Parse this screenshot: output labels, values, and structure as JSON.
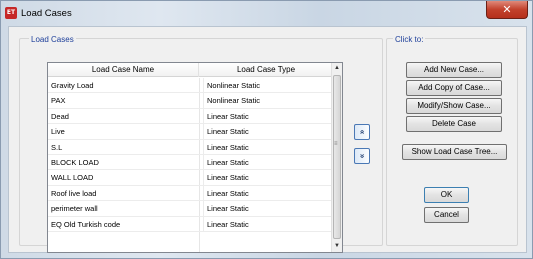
{
  "window": {
    "title": "Load Cases",
    "app_icon": "ET",
    "close_glyph": "✕"
  },
  "load_cases_group": {
    "title": "Load Cases",
    "columns": [
      "Load Case Name",
      "Load Case Type"
    ],
    "rows": [
      {
        "name": "Gravity Load",
        "type": "Nonlinear Static"
      },
      {
        "name": "PAX",
        "type": "Nonlinear Static"
      },
      {
        "name": "Dead",
        "type": "Linear Static"
      },
      {
        "name": "Live",
        "type": "Linear Static"
      },
      {
        "name": "S.L",
        "type": "Linear Static"
      },
      {
        "name": "BLOCK LOAD",
        "type": "Linear Static"
      },
      {
        "name": "WALL LOAD",
        "type": "Linear Static"
      },
      {
        "name": "Roof live load",
        "type": "Linear Static"
      },
      {
        "name": "perimeter wall",
        "type": "Linear Static"
      },
      {
        "name": "EQ Old Turkish code",
        "type": "Linear Static"
      }
    ],
    "move_up_glyph": "«",
    "move_down_glyph": "»"
  },
  "click_to": {
    "title": "Click to:",
    "add_new": "Add New Case...",
    "add_copy": "Add Copy of Case...",
    "modify_show": "Modify/Show Case...",
    "delete": "Delete Case",
    "show_tree": "Show Load Case Tree..."
  },
  "dialog_buttons": {
    "ok": "OK",
    "cancel": "Cancel"
  },
  "colors": {
    "group_title": "#1e3f9a",
    "close_button": "#c2412c",
    "app_icon": "#c62828"
  }
}
